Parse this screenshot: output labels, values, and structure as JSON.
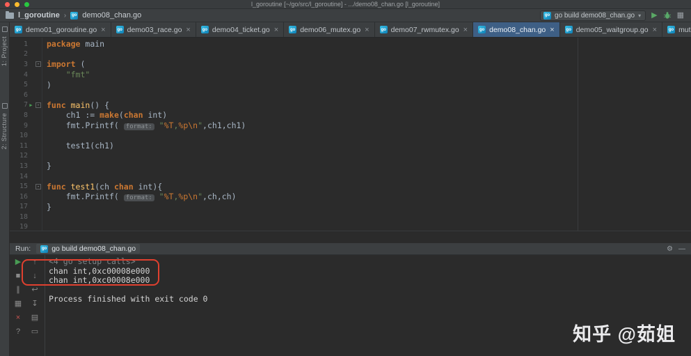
{
  "colors": {
    "active_tab": "#3e5f85",
    "annotation_red": "#e0402f",
    "run_green": "#499c54",
    "keyword_orange": "#cc7832",
    "string_green": "#6a8759"
  },
  "title_bar": {
    "title": "l_goroutine [~/go/src/l_goroutine] - .../demo08_chan.go [l_goroutine]"
  },
  "navbar": {
    "project": "l_goroutine",
    "file": "demo08_chan.go",
    "run_config": "go build demo08_chan.go"
  },
  "icons": {
    "caret_down": "▾",
    "play": "▶",
    "coverage": "▦",
    "tab_caret": "▾",
    "menu": "≡",
    "gear": "⚙",
    "hide": "—"
  },
  "sidebar": {
    "labels": [
      "1: Project",
      "2: Structure"
    ]
  },
  "tabs": [
    {
      "label": "demo01_goroutine.go",
      "active": false
    },
    {
      "label": "demo03_race.go",
      "active": false
    },
    {
      "label": "demo04_ticket.go",
      "active": false
    },
    {
      "label": "demo06_mutex.go",
      "active": false
    },
    {
      "label": "demo07_rwmutex.go",
      "active": false
    },
    {
      "label": "demo08_chan.go",
      "active": true
    },
    {
      "label": "demo05_waitgroup.go",
      "active": false
    },
    {
      "label": "mutex.go",
      "active": false
    }
  ],
  "editor": {
    "line_count": 19,
    "run_line": 7,
    "fold_lines": [
      3,
      7,
      15
    ],
    "lines": [
      [
        {
          "t": "package",
          "c": "kw"
        },
        {
          "t": " main",
          "c": "txt"
        }
      ],
      [],
      [
        {
          "t": "import",
          "c": "kw"
        },
        {
          "t": " (",
          "c": "txt"
        }
      ],
      [
        {
          "t": "    ",
          "c": "txt"
        },
        {
          "t": "\"fmt\"",
          "c": "str"
        }
      ],
      [
        {
          "t": ")",
          "c": "txt"
        }
      ],
      [],
      [
        {
          "t": "func ",
          "c": "kw"
        },
        {
          "t": "main",
          "c": "fn"
        },
        {
          "t": "() {",
          "c": "txt"
        }
      ],
      [
        {
          "t": "    ch1 := ",
          "c": "txt"
        },
        {
          "t": "make",
          "c": "kw"
        },
        {
          "t": "(",
          "c": "txt"
        },
        {
          "t": "chan",
          "c": "kw"
        },
        {
          "t": " int)",
          "c": "txt"
        }
      ],
      [
        {
          "t": "    fmt.Printf( ",
          "c": "txt"
        },
        {
          "t": "format:",
          "c": "hint"
        },
        {
          "t": " ",
          "c": "txt"
        },
        {
          "t": "\"",
          "c": "str"
        },
        {
          "t": "%T",
          "c": "esc"
        },
        {
          "t": ",",
          "c": "str"
        },
        {
          "t": "%p",
          "c": "esc"
        },
        {
          "t": "\\n",
          "c": "esc"
        },
        {
          "t": "\"",
          "c": "str"
        },
        {
          "t": ",ch1,ch1)",
          "c": "txt"
        }
      ],
      [],
      [
        {
          "t": "    test1(ch1)",
          "c": "txt"
        }
      ],
      [],
      [
        {
          "t": "}",
          "c": "txt"
        }
      ],
      [],
      [
        {
          "t": "func ",
          "c": "kw"
        },
        {
          "t": "test1",
          "c": "fn"
        },
        {
          "t": "(ch ",
          "c": "txt"
        },
        {
          "t": "chan",
          "c": "kw"
        },
        {
          "t": " int){",
          "c": "txt"
        }
      ],
      [
        {
          "t": "    fmt.Printf( ",
          "c": "txt"
        },
        {
          "t": "format:",
          "c": "hint"
        },
        {
          "t": " ",
          "c": "txt"
        },
        {
          "t": "\"",
          "c": "str"
        },
        {
          "t": "%T",
          "c": "esc"
        },
        {
          "t": ",",
          "c": "str"
        },
        {
          "t": "%p",
          "c": "esc"
        },
        {
          "t": "\\n",
          "c": "esc"
        },
        {
          "t": "\"",
          "c": "str"
        },
        {
          "t": ",ch,ch)",
          "c": "txt"
        }
      ],
      [
        {
          "t": "}",
          "c": "txt"
        }
      ],
      [],
      []
    ]
  },
  "run_panel": {
    "title": "Run:",
    "tab": "go build demo08_chan.go",
    "toolbar_left": [
      {
        "name": "rerun-button",
        "glyph": "▶",
        "color": "#499c54"
      },
      {
        "name": "stop-button",
        "glyph": "■",
        "color": "#8a8a8a"
      },
      {
        "name": "pause-output-button",
        "glyph": "∥",
        "color": "#8a8a8a"
      },
      {
        "name": "restore-layout-button",
        "glyph": "▦",
        "color": "#8a8a8a"
      },
      {
        "name": "close-button",
        "glyph": "×",
        "color": "#c75450"
      },
      {
        "name": "help-button",
        "glyph": "?",
        "color": "#8a8a8a"
      }
    ],
    "toolbar_right": [
      {
        "name": "up-stack-button",
        "glyph": "↑",
        "color": "#8a8a8a"
      },
      {
        "name": "down-stack-button",
        "glyph": "↓",
        "color": "#8a8a8a"
      },
      {
        "name": "soft-wrap-button",
        "glyph": "↩",
        "color": "#8a8a8a"
      },
      {
        "name": "scroll-end-button",
        "glyph": "↧",
        "color": "#8a8a8a"
      },
      {
        "name": "print-button",
        "glyph": "▤",
        "color": "#8a8a8a"
      },
      {
        "name": "clear-button",
        "glyph": "▭",
        "color": "#8a8a8a"
      }
    ],
    "console": [
      {
        "text": "<4 go setup calls>",
        "dim": true
      },
      {
        "text": "chan int,0xc00008e000",
        "dim": false
      },
      {
        "text": "chan int,0xc00008e000",
        "dim": false
      },
      {
        "text": "",
        "dim": false
      },
      {
        "text": "Process finished with exit code 0",
        "dim": false
      }
    ]
  },
  "watermark": "知乎 @茹姐"
}
